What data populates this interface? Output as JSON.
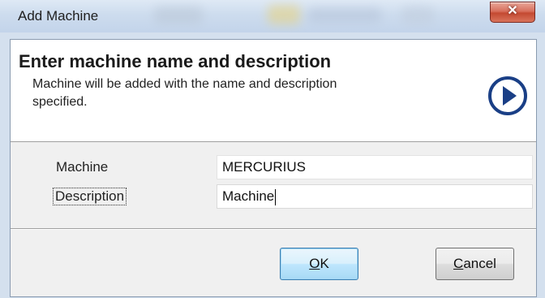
{
  "window": {
    "title": "Add Machine"
  },
  "header": {
    "title": "Enter machine name and description",
    "description": "Machine will be added with the name and description specified.",
    "icon": "next-arrow-icon"
  },
  "form": {
    "machine_label": "Machine",
    "machine_value": "MERCURIUS",
    "description_label": "Description",
    "description_value": "Machine"
  },
  "buttons": {
    "ok_mnemonic": "O",
    "ok_rest": "K",
    "cancel_mnemonic": "C",
    "cancel_rest": "ancel"
  },
  "colors": {
    "icon_blue": "#1a3f86",
    "close_red": "#c44a32",
    "default_button_border": "#3c7fb1"
  }
}
